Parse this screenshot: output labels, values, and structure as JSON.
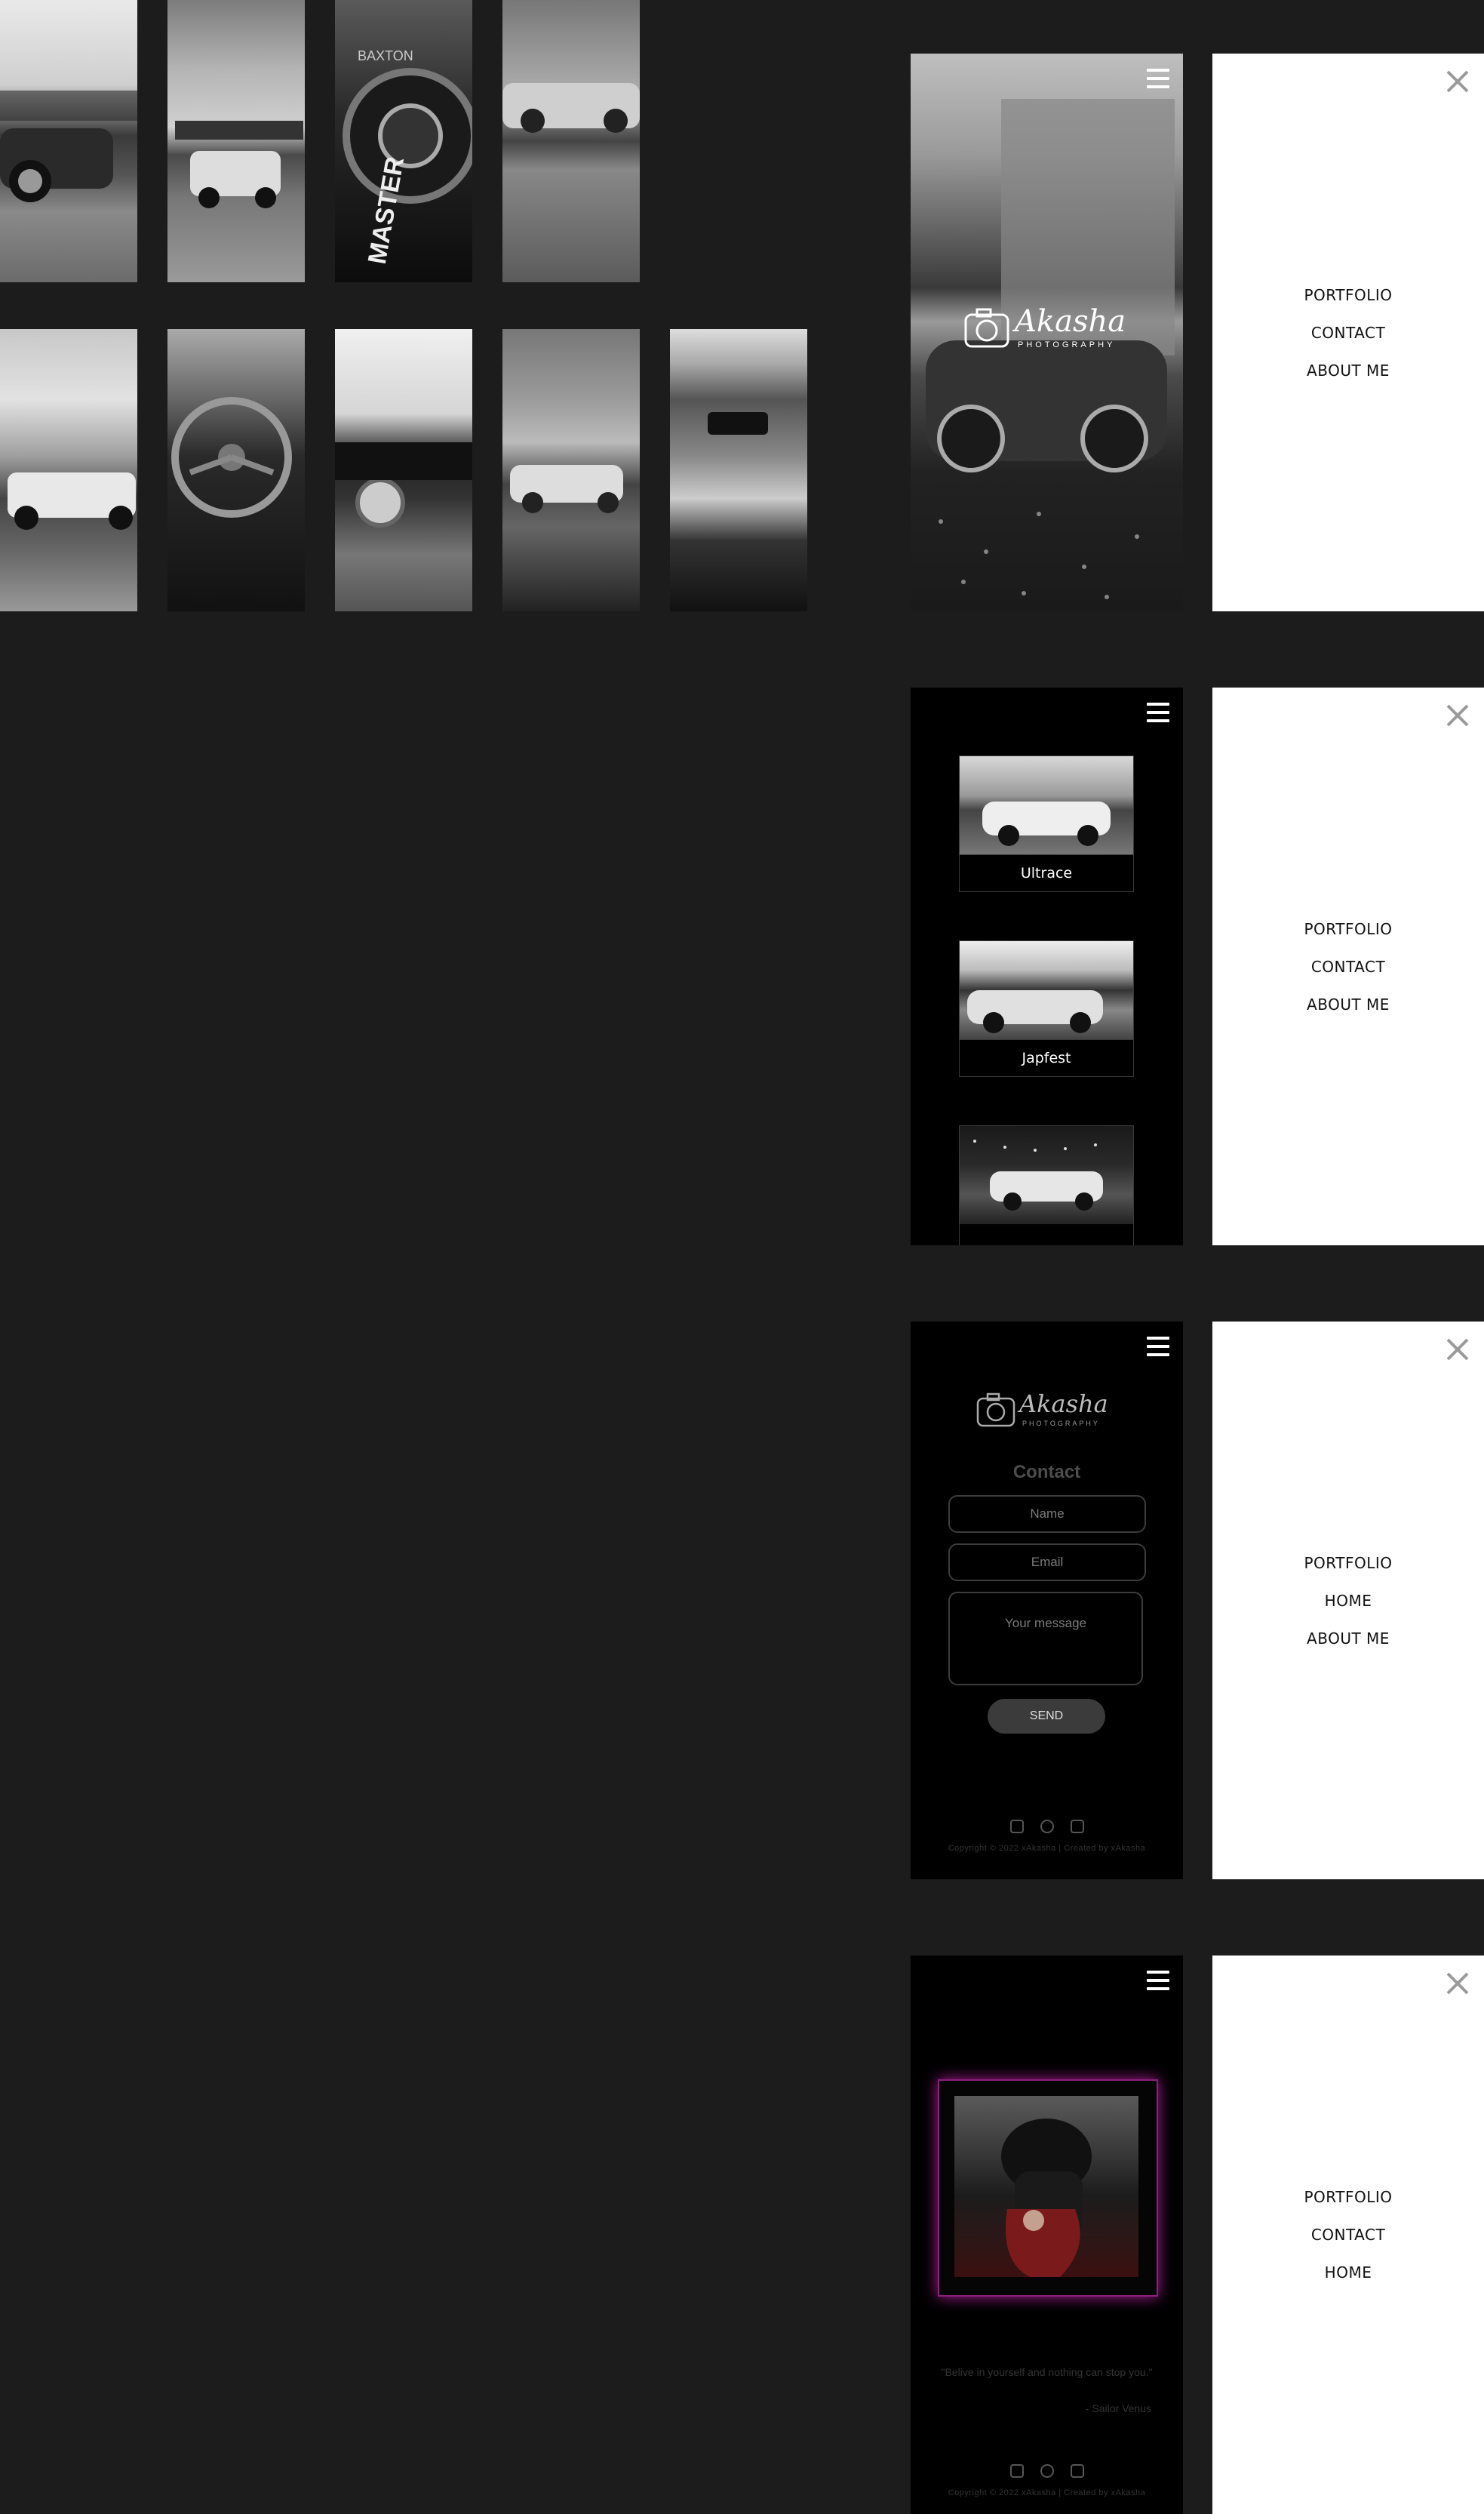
{
  "home": {
    "logo_script": "Akasha",
    "logo_sub": "PHOTOGRAPHY"
  },
  "menu_home": {
    "items": [
      "PORTFOLIO",
      "CONTACT",
      "ABOUT ME"
    ]
  },
  "portfolio": {
    "cards": [
      {
        "label": "Ultrace"
      },
      {
        "label": "Japfest"
      }
    ]
  },
  "menu_portfolio": {
    "items": [
      "PORTFOLIO",
      "CONTACT",
      "ABOUT ME"
    ]
  },
  "contact": {
    "logo_script": "Akasha",
    "logo_sub": "PHOTOGRAPHY",
    "title": "Contact",
    "name_placeholder": "Name",
    "email_placeholder": "Email",
    "message_placeholder": "Your message",
    "send_label": "SEND",
    "footer": "Copyright © 2022 xAkasha | Created by xAkasha"
  },
  "menu_contact": {
    "items": [
      "PORTFOLIO",
      "HOME",
      "ABOUT ME"
    ]
  },
  "about": {
    "quote": "\"Belive in yourself and nothing can stop you.\"",
    "quote_author": "- Sailor Venus",
    "footer": "Copyright © 2022 xAkasha | Created by xAkasha"
  },
  "menu_about": {
    "items": [
      "PORTFOLIO",
      "CONTACT",
      "HOME"
    ]
  },
  "icons": {
    "menu": "hamburger-icon",
    "close": "close-icon",
    "camera": "camera-icon",
    "instagram": "instagram-icon",
    "facebook": "facebook-icon",
    "trash": "tiktok-icon"
  },
  "colors": {
    "background": "#1c1c1c",
    "phone_bg": "#000000",
    "menu_bg": "#ffffff",
    "accent_glow": "#b01e9a"
  }
}
